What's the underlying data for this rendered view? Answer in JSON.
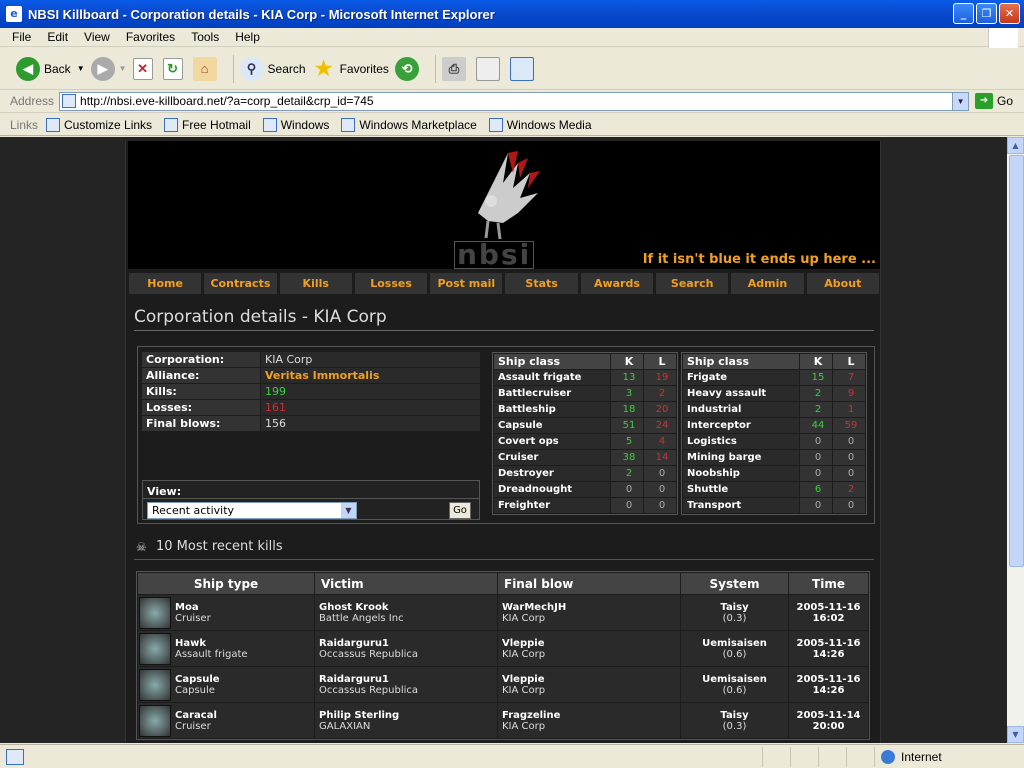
{
  "window": {
    "title": "NBSI Killboard - Corporation details - KIA Corp - Microsoft Internet Explorer"
  },
  "menu": [
    "File",
    "Edit",
    "View",
    "Favorites",
    "Tools",
    "Help"
  ],
  "toolbar": {
    "back": "Back",
    "search": "Search",
    "favorites": "Favorites"
  },
  "address": {
    "label": "Address",
    "url": "http://nbsi.eve-killboard.net/?a=corp_detail&crp_id=745",
    "go": "Go"
  },
  "links": {
    "label": "Links",
    "items": [
      "Customize Links",
      "Free Hotmail",
      "Windows",
      "Windows Marketplace",
      "Windows Media"
    ]
  },
  "status": {
    "zone": "Internet"
  },
  "banner": {
    "brand": "nbsi",
    "tagline": "If it isn't blue it ends up here ..."
  },
  "nav": [
    "Home",
    "Contracts",
    "Kills",
    "Losses",
    "Post mail",
    "Stats",
    "Awards",
    "Search",
    "Admin",
    "About"
  ],
  "page_title": "Corporation details - KIA Corp",
  "corp": [
    {
      "k": "Corporation:",
      "v": "KIA Corp",
      "c": ""
    },
    {
      "k": "Alliance:",
      "v": "Veritas Immortalis",
      "c": "alliance"
    },
    {
      "k": "Kills:",
      "v": "199",
      "c": "g"
    },
    {
      "k": "Losses:",
      "v": "161",
      "c": "r"
    },
    {
      "k": "Final blows:",
      "v": "156",
      "c": ""
    }
  ],
  "view": {
    "label": "View:",
    "selected": "Recent activity",
    "go": "Go"
  },
  "ship_header": {
    "cls": "Ship class",
    "k": "K",
    "l": "L"
  },
  "ships_left": [
    {
      "n": "Assault frigate",
      "k": "13",
      "l": "19"
    },
    {
      "n": "Battlecruiser",
      "k": "3",
      "l": "2"
    },
    {
      "n": "Battleship",
      "k": "18",
      "l": "20"
    },
    {
      "n": "Capsule",
      "k": "51",
      "l": "24"
    },
    {
      "n": "Covert ops",
      "k": "5",
      "l": "4"
    },
    {
      "n": "Cruiser",
      "k": "38",
      "l": "14"
    },
    {
      "n": "Destroyer",
      "k": "2",
      "l": "0"
    },
    {
      "n": "Dreadnought",
      "k": "0",
      "l": "0"
    },
    {
      "n": "Freighter",
      "k": "0",
      "l": "0"
    }
  ],
  "ships_right": [
    {
      "n": "Frigate",
      "k": "15",
      "l": "7"
    },
    {
      "n": "Heavy assault",
      "k": "2",
      "l": "9"
    },
    {
      "n": "Industrial",
      "k": "2",
      "l": "1"
    },
    {
      "n": "Interceptor",
      "k": "44",
      "l": "59"
    },
    {
      "n": "Logistics",
      "k": "0",
      "l": "0"
    },
    {
      "n": "Mining barge",
      "k": "0",
      "l": "0"
    },
    {
      "n": "Noobship",
      "k": "0",
      "l": "0"
    },
    {
      "n": "Shuttle",
      "k": "6",
      "l": "2"
    },
    {
      "n": "Transport",
      "k": "0",
      "l": "0"
    }
  ],
  "recent_title": "10 Most recent kills",
  "kills_header": [
    "Ship type",
    "Victim",
    "Final blow",
    "System",
    "Time"
  ],
  "kills": [
    {
      "ship": "Moa",
      "cls": "Cruiser",
      "victim": "Ghost Krook",
      "vcorp": "Battle Angels Inc",
      "fb": "WarMechJH",
      "fbcorp": "KIA Corp",
      "sys": "Taisy",
      "sec": "(0.3)",
      "date": "2005-11-16",
      "time": "16:02"
    },
    {
      "ship": "Hawk",
      "cls": "Assault frigate",
      "victim": "Raidarguru1",
      "vcorp": "Occassus Republica",
      "fb": "Vleppie",
      "fbcorp": "KIA Corp",
      "sys": "Uemisaisen",
      "sec": "(0.6)",
      "date": "2005-11-16",
      "time": "14:26"
    },
    {
      "ship": "Capsule",
      "cls": "Capsule",
      "victim": "Raidarguru1",
      "vcorp": "Occassus Republica",
      "fb": "Vleppie",
      "fbcorp": "KIA Corp",
      "sys": "Uemisaisen",
      "sec": "(0.6)",
      "date": "2005-11-16",
      "time": "14:26"
    },
    {
      "ship": "Caracal",
      "cls": "Cruiser",
      "victim": "Philip Sterling",
      "vcorp": "GALAXIAN",
      "fb": "Fragzeline",
      "fbcorp": "KIA Corp",
      "sys": "Taisy",
      "sec": "(0.3)",
      "date": "2005-11-14",
      "time": "20:00"
    }
  ],
  "colors": {
    "accent": "#f0a020",
    "green": "#3ad03a",
    "red": "#d03030"
  }
}
